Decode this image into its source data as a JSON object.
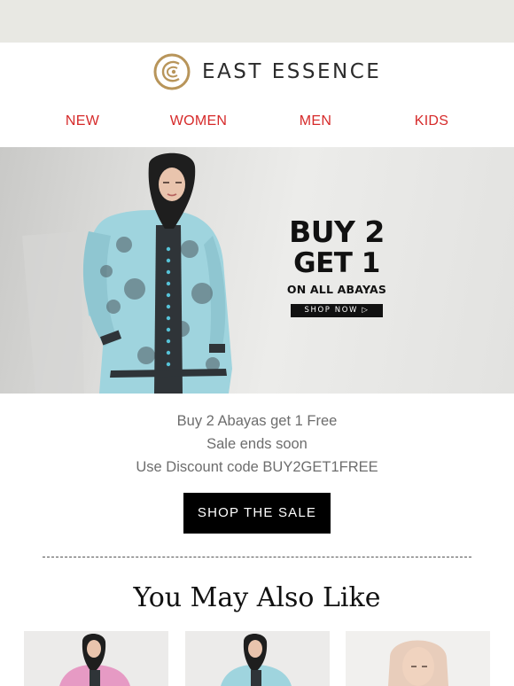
{
  "brand": {
    "name": "EAST ESSENCE",
    "accent_color": "#b8955a"
  },
  "nav": {
    "items": [
      {
        "label": "NEW"
      },
      {
        "label": "WOMEN"
      },
      {
        "label": "MEN"
      },
      {
        "label": "KIDS"
      }
    ],
    "color": "#d62a2a"
  },
  "hero": {
    "line1": "BUY 2",
    "line2": "GET 1",
    "line3": "ON ALL ABAYAS",
    "button_label": "SHOP NOW"
  },
  "promo_copy": {
    "line1": "Buy 2 Abayas get 1 Free",
    "line2": "Sale ends soon",
    "line3": "Use Discount code BUY2GET1FREE"
  },
  "cta": {
    "label": "SHOP THE SALE"
  },
  "recommendations": {
    "title": "You May Also Like",
    "products": [
      {
        "icon": "pink-abaya-photo"
      },
      {
        "icon": "blue-abaya-photo"
      },
      {
        "icon": "beige-hijab-photo"
      }
    ]
  }
}
